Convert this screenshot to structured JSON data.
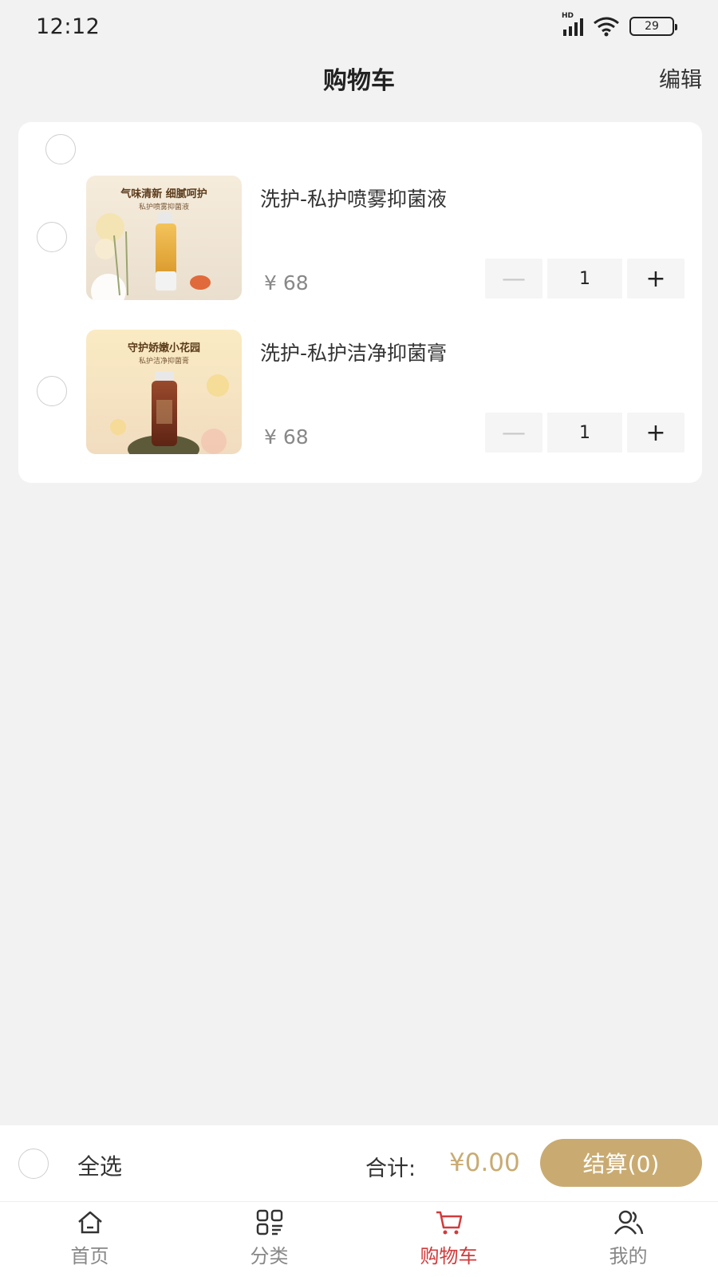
{
  "status_bar": {
    "time": "12:12",
    "network": "HD",
    "battery": "29"
  },
  "header": {
    "title": "购物车",
    "edit_label": "编辑"
  },
  "cart": {
    "items": [
      {
        "title": "洗护-私护喷雾抑菌液",
        "price": "¥ 68",
        "quantity": "1",
        "image_caption": "气味清新 细腻呵护",
        "image_sub": "私护喷雾抑菌液"
      },
      {
        "title": "洗护-私护洁净抑菌膏",
        "price": "¥ 68",
        "quantity": "1",
        "image_caption": "守护娇嫩小花园",
        "image_sub": "私护洁净抑菌膏"
      }
    ],
    "minus_symbol": "—",
    "plus_symbol": "+"
  },
  "footer": {
    "select_all_label": "全选",
    "total_label": "合计:",
    "total_amount": "¥0.00",
    "checkout_label": "结算(0)"
  },
  "tabs": [
    {
      "label": "首页",
      "icon": "home-icon",
      "active": false
    },
    {
      "label": "分类",
      "icon": "category-icon",
      "active": false
    },
    {
      "label": "购物车",
      "icon": "cart-icon",
      "active": true
    },
    {
      "label": "我的",
      "icon": "user-icon",
      "active": false
    }
  ],
  "colors": {
    "accent": "#c9ab72",
    "active_tab": "#d23b3b",
    "background": "#f2f2f2"
  }
}
